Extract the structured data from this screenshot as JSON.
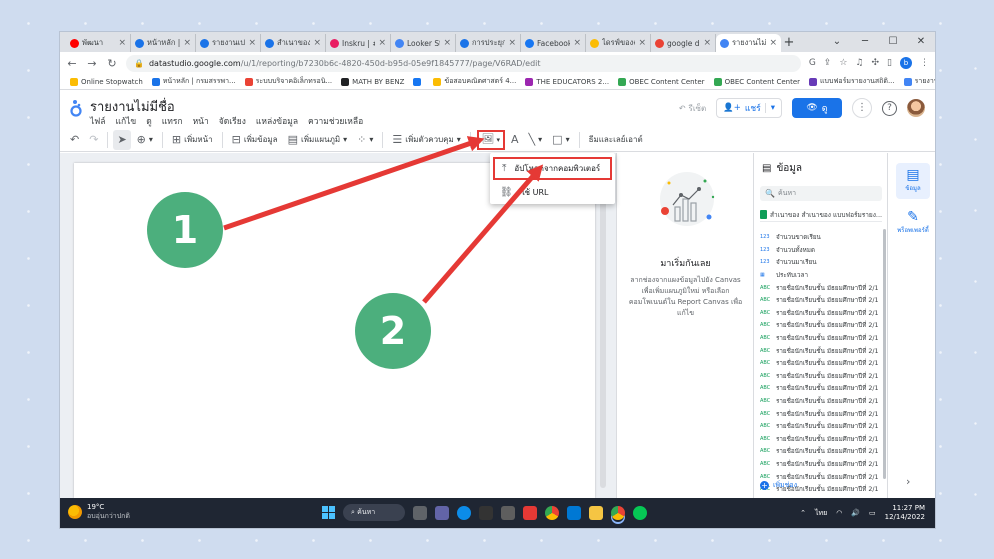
{
  "browser": {
    "tabs": [
      {
        "title": "พัฒนา",
        "color": "#ff0000"
      },
      {
        "title": "หน้าหลัก |",
        "color": "#1a73e8"
      },
      {
        "title": "รายงานเปล่",
        "color": "#1a73e8"
      },
      {
        "title": "สำเนาของ",
        "color": "#1a73e8"
      },
      {
        "title": "Inskru | #",
        "color": "#e91e63"
      },
      {
        "title": "Looker St",
        "color": "#4285f4"
      },
      {
        "title": "การประยุก",
        "color": "#1a73e8"
      },
      {
        "title": "Facebook",
        "color": "#1877f2"
      },
      {
        "title": "ไดรฟ์ของฉ",
        "color": "#fbbc04"
      },
      {
        "title": "google d",
        "color": "#ea4335"
      },
      {
        "title": "รายงานไม่",
        "color": "#4285f4"
      }
    ],
    "url_host": "datastudio.google.com",
    "url_path": "/u/1/reporting/b7230b6c-4820-450d-b95d-05e9f1845777/page/V6RAD/edit",
    "profile_initial": "b",
    "bookmarks": [
      {
        "label": "Online Stopwatch",
        "color": "#fbbc04"
      },
      {
        "label": "หน้าหลัก | กรมสรรพา...",
        "color": "#1a73e8"
      },
      {
        "label": "ระบบบริจาคอิเล็กทรอนิ...",
        "color": "#ea4335"
      },
      {
        "label": "MATH BY BENZ",
        "color": "#202124"
      },
      {
        "label": "",
        "color": "#1877f2"
      },
      {
        "label": "ข้อสอบคณิตศาสตร์ 4...",
        "color": "#fbbc04"
      },
      {
        "label": "THE EDUCATORS 2...",
        "color": "#9c27b0"
      },
      {
        "label": "OBEC Content Center",
        "color": "#34a853"
      },
      {
        "label": "OBEC Content Center",
        "color": "#34a853"
      },
      {
        "label": "แบบฟอร์มรายงานสถิติ...",
        "color": "#673ab7"
      },
      {
        "label": "รายงานสถิติการมาเรีย...",
        "color": "#4285f4"
      }
    ]
  },
  "app": {
    "report_title": "รายงานไม่มีชื่อ",
    "menus": [
      "ไฟล์",
      "แก้ไข",
      "ดู",
      "แทรก",
      "หน้า",
      "จัดเรียง",
      "แหล่งข้อมูล",
      "ความช่วยเหลือ"
    ],
    "reset_label": "รีเซ็ต",
    "share_label": "แชร์",
    "view_label": "ดู"
  },
  "toolbar": {
    "add_page": "เพิ่มหน้า",
    "add_data": "เพิ่มข้อมูล",
    "add_chart": "เพิ่มแผนภูมิ",
    "add_control": "เพิ่มตัวควบคุม",
    "theme_layout": "ธีมและเลย์เอาต์"
  },
  "image_menu": {
    "upload": "อัปโหลดจากคอมพิวเตอร์",
    "url": "ใช้ URL"
  },
  "middle_panel": {
    "title": "มาเริ่มกันเลย",
    "description": "ลากช่องจากแผงข้อมูลไปยัง Canvas เพื่อเพิ่มแผนภูมิใหม่ หรือเลือกคอมโพเนนต์ใน Report Canvas เพื่อแก้ไข"
  },
  "data_panel": {
    "title": "ข้อมูล",
    "search_placeholder": "ค้นหา",
    "source": "สำเนาของ สำเนาของ แบบฟอร์มรายง...",
    "fields": [
      {
        "type": "123",
        "name": "จำนวนขาดเรียน"
      },
      {
        "type": "123",
        "name": "จำนวนทั้งหมด"
      },
      {
        "type": "123",
        "name": "จำนวนมาเรียน"
      },
      {
        "type": "cal",
        "name": "ประทับเวลา"
      },
      {
        "type": "ABC",
        "name": "รายชื่อนักเรียนชั้น มัธยมศึกษาปีที่ 2/1 ..."
      },
      {
        "type": "ABC",
        "name": "รายชื่อนักเรียนชั้น มัธยมศึกษาปีที่ 2/1 ..."
      },
      {
        "type": "ABC",
        "name": "รายชื่อนักเรียนชั้น มัธยมศึกษาปีที่ 2/1 ..."
      },
      {
        "type": "ABC",
        "name": "รายชื่อนักเรียนชั้น มัธยมศึกษาปีที่ 2/1 ..."
      },
      {
        "type": "ABC",
        "name": "รายชื่อนักเรียนชั้น มัธยมศึกษาปีที่ 2/1 ..."
      },
      {
        "type": "ABC",
        "name": "รายชื่อนักเรียนชั้น มัธยมศึกษาปีที่ 2/1 ..."
      },
      {
        "type": "ABC",
        "name": "รายชื่อนักเรียนชั้น มัธยมศึกษาปีที่ 2/1 ..."
      },
      {
        "type": "ABC",
        "name": "รายชื่อนักเรียนชั้น มัธยมศึกษาปีที่ 2/1 ..."
      },
      {
        "type": "ABC",
        "name": "รายชื่อนักเรียนชั้น มัธยมศึกษาปีที่ 2/1 ..."
      },
      {
        "type": "ABC",
        "name": "รายชื่อนักเรียนชั้น มัธยมศึกษาปีที่ 2/1 ..."
      },
      {
        "type": "ABC",
        "name": "รายชื่อนักเรียนชั้น มัธยมศึกษาปีที่ 2/1 ..."
      },
      {
        "type": "ABC",
        "name": "รายชื่อนักเรียนชั้น มัธยมศึกษาปีที่ 2/1 ..."
      },
      {
        "type": "ABC",
        "name": "รายชื่อนักเรียนชั้น มัธยมศึกษาปีที่ 2/1 ..."
      },
      {
        "type": "ABC",
        "name": "รายชื่อนักเรียนชั้น มัธยมศึกษาปีที่ 2/1 ..."
      },
      {
        "type": "ABC",
        "name": "รายชื่อนักเรียนชั้น มัธยมศึกษาปีที่ 2/1 ..."
      },
      {
        "type": "ABC",
        "name": "รายชื่อนักเรียนชั้น มัธยมศึกษาปีที่ 2/1 ..."
      },
      {
        "type": "ABC",
        "name": "รายชื่อนักเรียนชั้น มัธยมศึกษาปีที่ 2/1 ..."
      }
    ],
    "add_field": "เพิ่มช่อง"
  },
  "right_rail": {
    "data_tab": "ข้อมูล",
    "properties_tab": "พร็อพเพอร์ตี้"
  },
  "taskbar": {
    "temperature": "19°C",
    "weather_text": "อบอุ่นกว่าปกติ",
    "search": "ค้นหา",
    "language": "ไทย",
    "time": "11:27 PM",
    "date": "12/14/2022"
  },
  "annotations": [
    {
      "label": "1"
    },
    {
      "label": "2"
    }
  ],
  "colors": {
    "accent": "#1a73e8",
    "annotation_red": "#e53935",
    "badge_green": "#4caf7d"
  }
}
